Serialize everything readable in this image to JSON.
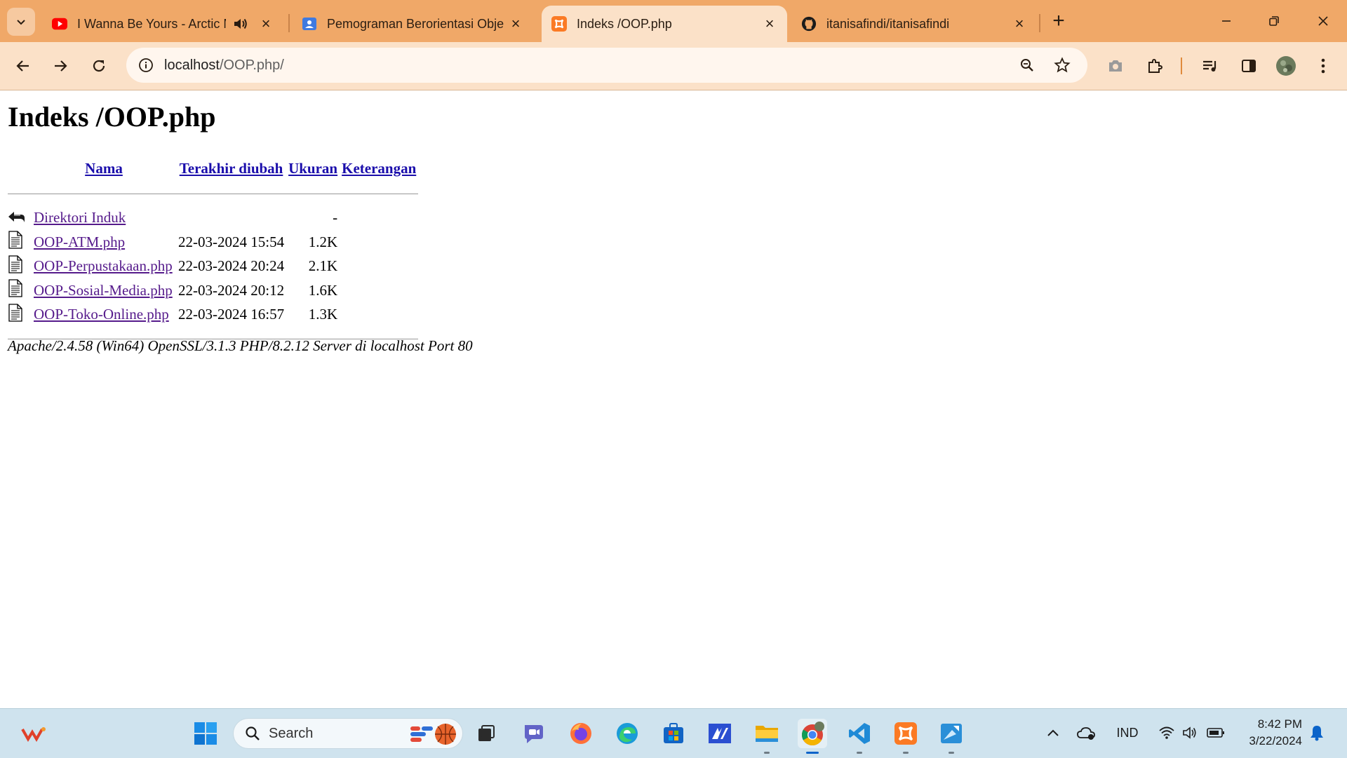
{
  "browser": {
    "tabs": [
      {
        "title": "I Wanna Be Yours - Arctic M",
        "favicon": "youtube-icon"
      },
      {
        "title": "Pemograman Berorientasi Obje",
        "favicon": "google-classroom-icon"
      },
      {
        "title": "Indeks /OOP.php",
        "favicon": "xampp-icon"
      },
      {
        "title": "itanisafindi/itanisafindi",
        "favicon": "github-icon"
      }
    ],
    "url_host": "localhost",
    "url_path": "/OOP.php/"
  },
  "page": {
    "heading": "Indeks /OOP.php",
    "columns": {
      "name": "Nama",
      "modified": "Terakhir diubah",
      "size": "Ukuran",
      "description": "Keterangan"
    },
    "parent": {
      "name": "Direktori Induk",
      "size": "-"
    },
    "files": [
      {
        "name": "OOP-ATM.php",
        "modified": "22-03-2024 15:54",
        "size": "1.2K"
      },
      {
        "name": "OOP-Perpustakaan.php",
        "modified": "22-03-2024 20:24",
        "size": "2.1K"
      },
      {
        "name": "OOP-Sosial-Media.php",
        "modified": "22-03-2024 20:12",
        "size": "1.6K"
      },
      {
        "name": "OOP-Toko-Online.php",
        "modified": "22-03-2024 16:57",
        "size": "1.3K"
      }
    ],
    "server_signature": "Apache/2.4.58 (Win64) OpenSSL/3.1.3 PHP/8.2.12 Server di localhost Port 80"
  },
  "taskbar": {
    "search_label": "Search",
    "language": "IND",
    "time": "8:42 PM",
    "date": "3/22/2024"
  },
  "colors": {
    "tabstrip": "#f0a868",
    "toolbar": "#fbe1c8",
    "link": "#1a0dab",
    "visited": "#551a8b"
  }
}
